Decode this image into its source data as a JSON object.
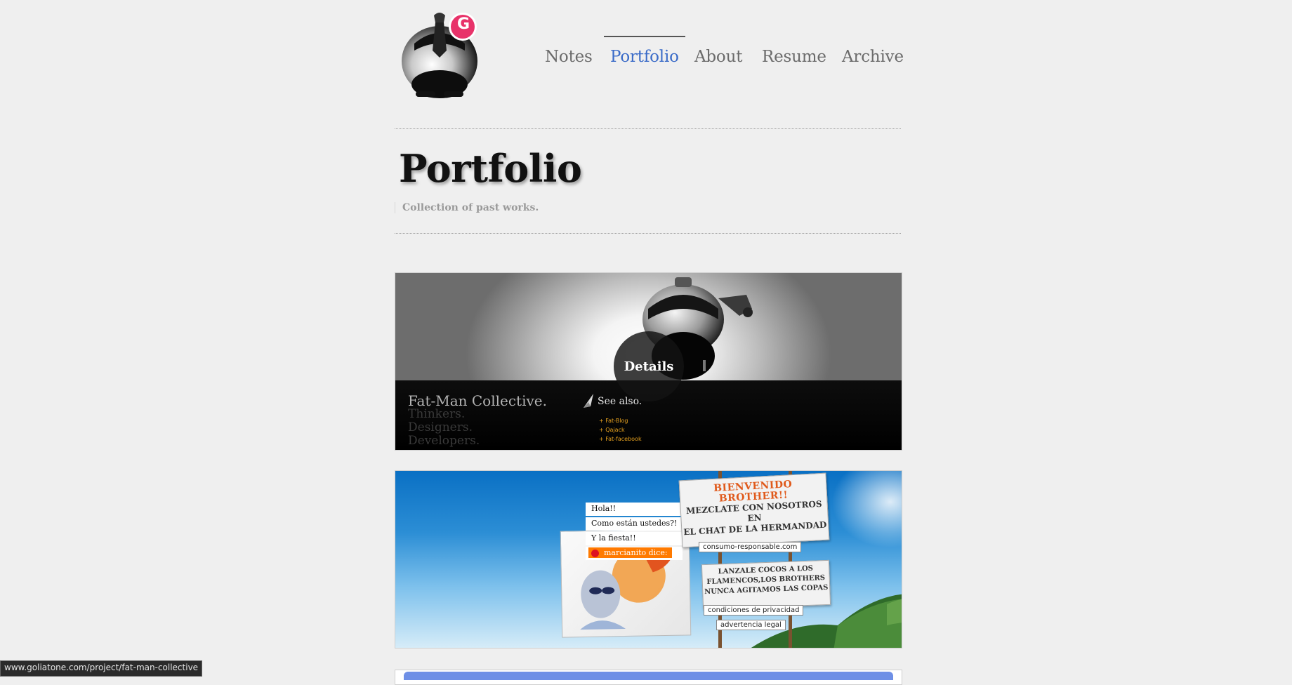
{
  "nav": {
    "items": [
      {
        "label": "Notes",
        "active": false
      },
      {
        "label": "Portfolio",
        "active": true
      },
      {
        "label": "About",
        "active": false
      },
      {
        "label": "Resume",
        "active": false
      },
      {
        "label": "Archive",
        "active": false
      }
    ],
    "logo_letter": "G",
    "accent_color": "#3a6bc8",
    "badge_color": "#e8336a"
  },
  "page": {
    "title": "Portfolio",
    "subtitle": "Collection of past works."
  },
  "projects": [
    {
      "name": "Fat-Man Collective.",
      "tagline": [
        "Thinkers.",
        "Designers.",
        "Developers."
      ],
      "details_label": "Details",
      "see_also_label": "See also.",
      "see_also_links": [
        "+ Fat-Blog",
        "+ Qajack",
        "+ Fat-facebook"
      ]
    },
    {
      "chat_lines": [
        "Hola!!",
        "Como están ustedes?!",
        "Y la fiesta!!"
      ],
      "chat_speaker": "marcianito dice:",
      "sign_headline": "BIENVENIDO BROTHER!!",
      "sign_lines": [
        "MEZCLATE CON NOSOTROS EN",
        "EL CHAT DE LA HERMANDAD"
      ],
      "arrow_sign_lines": [
        "LANZALE COCOS A LOS",
        "FLAMENCOS,LOS BROTHERS",
        "NUNCA AGITAMOS LAS COPAS"
      ],
      "link_tags": [
        "consumo-responsable.com",
        "condiciones de privacidad",
        "advertencia legal"
      ]
    }
  ],
  "status_bar": {
    "url": "www.goliatone.com/project/fat-man-collective"
  }
}
